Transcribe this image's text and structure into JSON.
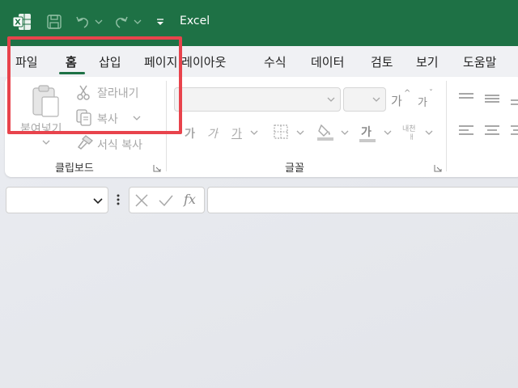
{
  "titlebar": {
    "app_title": "Excel",
    "icons": [
      "excel-logo-icon",
      "save-icon",
      "undo-icon",
      "redo-icon",
      "customize-quick-access-icon"
    ]
  },
  "tabs": [
    {
      "label": "파일",
      "active": false
    },
    {
      "label": "홈",
      "active": true
    },
    {
      "label": "삽입",
      "active": false
    },
    {
      "label": "페이지 레이아웃",
      "active": false
    },
    {
      "label": "수식",
      "active": false
    },
    {
      "label": "데이터",
      "active": false
    },
    {
      "label": "검토",
      "active": false
    },
    {
      "label": "보기",
      "active": false
    },
    {
      "label": "도움말",
      "active": false
    }
  ],
  "clipboard": {
    "paste": "붙여넣기",
    "cut": "잘라내기",
    "copy": "복사",
    "format_painter": "서식 복사",
    "group_label": "클립보드"
  },
  "font": {
    "group_label": "글꼴",
    "increase_size": "가",
    "decrease_size": "가",
    "bold": "가",
    "italic": "가",
    "underline": "가",
    "font_color": "가",
    "phonetic": "내천"
  },
  "colors": {
    "title_bg": "#1e7145",
    "accent": "#1e7145",
    "highlight_border": "#e8434c",
    "disabled_text": "#a8a8a8"
  },
  "formula_bar": {
    "fx_label": "fx"
  }
}
